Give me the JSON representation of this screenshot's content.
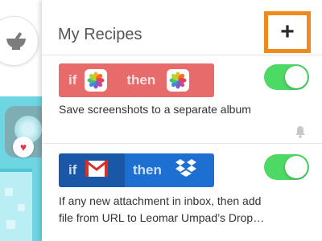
{
  "header": {
    "title": "My Recipes",
    "add_label": "+"
  },
  "recipes": [
    {
      "if_label": "if",
      "then_label": "then",
      "trigger_icon": "photos-icon",
      "action_icon": "photos-icon",
      "color": "#e86b6b",
      "description": "Save screenshots to a separate album",
      "enabled": true,
      "notification_icon": "bell-icon"
    },
    {
      "if_label": "if",
      "then_label": "then",
      "trigger_icon": "gmail-icon",
      "action_icon": "dropbox-icon",
      "color": "#1d6fd1",
      "description_line1": "If any new attachment in inbox, then add",
      "description_line2": "file from URL to Leomar Umpad’s Drop…",
      "enabled": true
    }
  ],
  "colors": {
    "accent_highlight": "#f08a1c",
    "toggle_on": "#4cd964"
  }
}
